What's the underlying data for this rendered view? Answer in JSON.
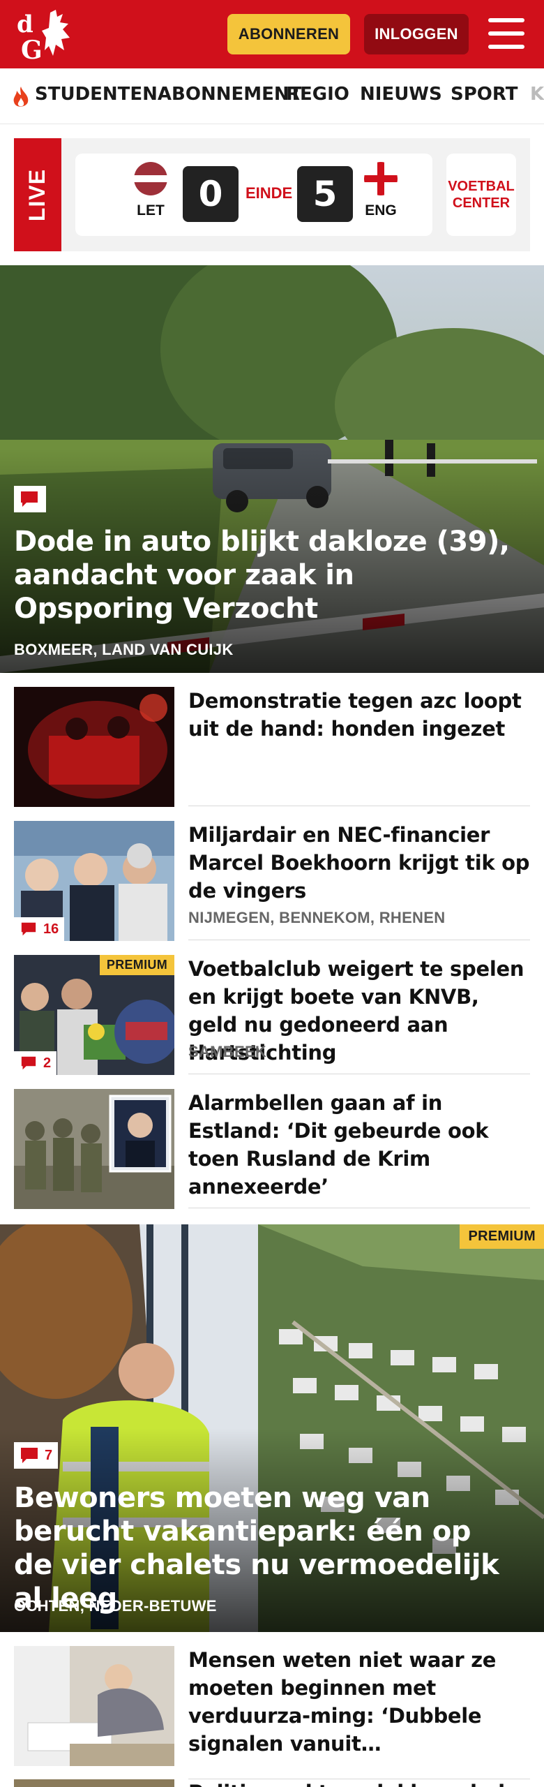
{
  "header": {
    "logo_text": "dG",
    "subscribe_label": "ABONNEREN",
    "login_label": "INLOGGEN",
    "brand_color": "#d0101b"
  },
  "nav": {
    "items": [
      "STUDENTENABONNEMENT",
      "REGIO",
      "NIEUWS",
      "SPORT",
      "K"
    ]
  },
  "live": {
    "tag": "LIVE",
    "home_code": "LET",
    "home_score": "0",
    "status": "EINDE",
    "away_score": "5",
    "away_code": "ENG",
    "center_label_1": "VOETBAL",
    "center_label_2": "CENTER"
  },
  "hero1": {
    "title": "Dode in auto blijkt dakloze (39), aandacht voor zaak in Opsporing Verzocht",
    "location": "BOXMEER, LAND VAN CUIJK"
  },
  "articles": [
    {
      "title": "Demonstratie tegen azc loopt uit de hand: honden ingezet",
      "location": "",
      "comments": "",
      "premium": ""
    },
    {
      "title": "Miljardair en NEC-financier Marcel Boekhoorn krijgt tik op de vingers",
      "location": "NIJMEGEN, BENNEKOM, RHENEN",
      "comments": "16",
      "premium": ""
    },
    {
      "title": "Voetbalclub weigert te spelen en krijgt boete van KNVB, geld nu gedoneerd aan Hartstichting",
      "location": "SAMBEEK",
      "comments": "2",
      "premium": "PREMIUM"
    },
    {
      "title": "Alarmbellen gaan af in Estland: ‘Dit gebeurde ook toen Rusland de Krim annexeerde’",
      "location": "",
      "comments": "",
      "premium": ""
    }
  ],
  "hero2": {
    "premium": "PREMIUM",
    "comments": "7",
    "title": "Bewoners moeten weg van berucht vakantiepark: één op de vier chalets nu vermoedelijk al leeg",
    "location": "OCHTEN, NEDER-BETUWE"
  },
  "articles2": [
    {
      "title": "Mensen weten niet waar ze moeten beginnen met verduurza-ming: ‘Dubbele signalen vanuit…",
      "location": ""
    },
    {
      "title": "Politie zoekt na dakloze dode in",
      "location": ""
    }
  ]
}
